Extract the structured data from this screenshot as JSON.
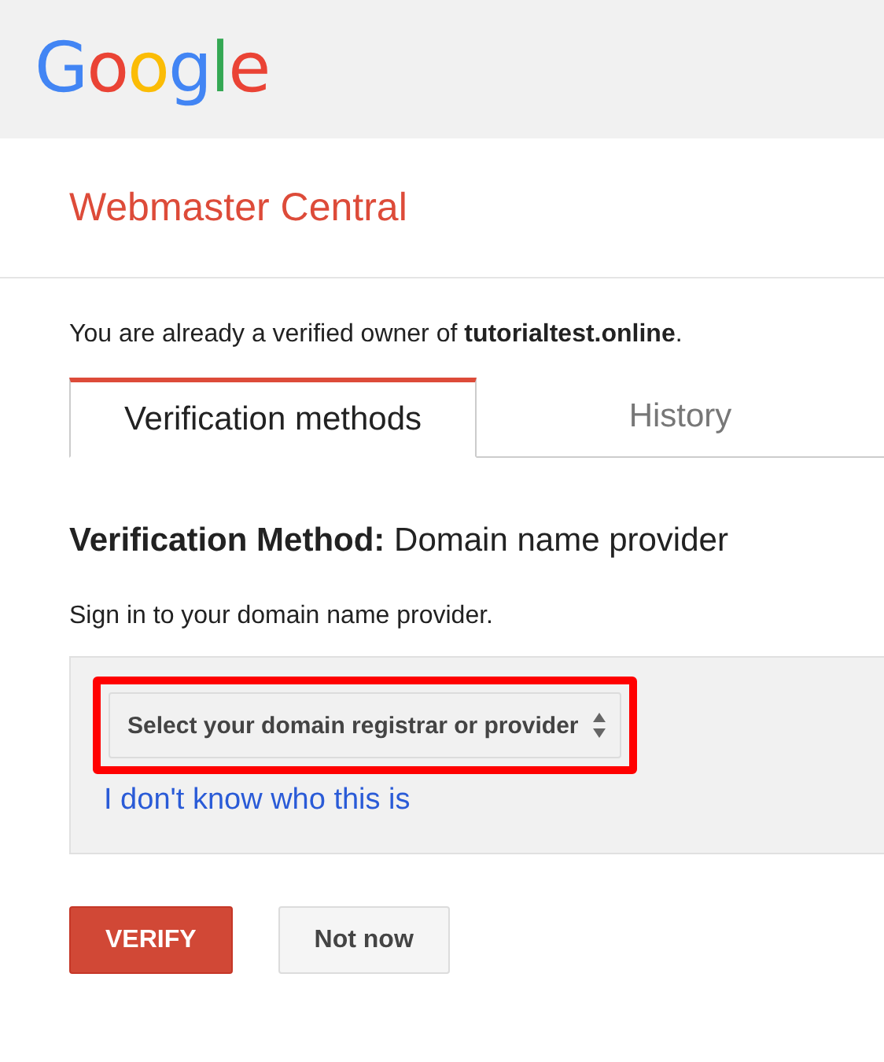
{
  "header": {
    "logo": "Google"
  },
  "title": "Webmaster Central",
  "ownership_note": "You are already a verified owner of **tutorialtest.online**.",
  "tabs": [
    {
      "label": "Verification methods",
      "selected": true
    },
    {
      "label": "History",
      "selected": false
    }
  ],
  "method_heading": "**Verification Method:** Domain name provider",
  "instruction": "Sign in to your domain name provider.",
  "provider_select": {
    "value": "Select your domain registrar or provider",
    "highlighted": true
  },
  "help_link": "I don't know who this is",
  "buttons": [
    {
      "label": "VERIFY",
      "kind": "primary"
    },
    {
      "label": "Not now",
      "kind": "secondary"
    }
  ]
}
